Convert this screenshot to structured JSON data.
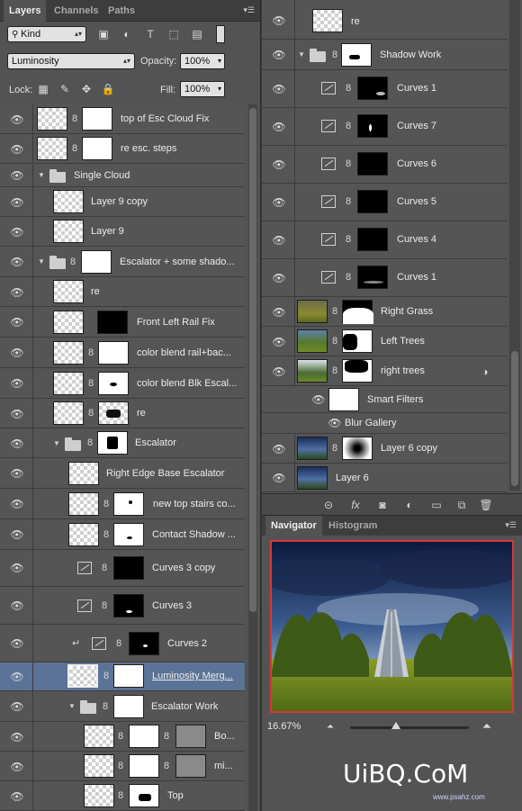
{
  "panel_tabs": [
    "Layers",
    "Channels",
    "Paths"
  ],
  "filter": {
    "kind_label": "Kind"
  },
  "blend": {
    "mode": "Luminosity",
    "opacity_label": "Opacity:",
    "opacity": "100%",
    "lock_label": "Lock:",
    "fill_label": "Fill:",
    "fill": "100%"
  },
  "layers_left": [
    {
      "name": "top of Esc Cloud Fix"
    },
    {
      "name": "re esc. steps"
    },
    {
      "name": "Single Cloud"
    },
    {
      "name": "Layer 9 copy"
    },
    {
      "name": "Layer 9"
    },
    {
      "name": "Escalator + some shado..."
    },
    {
      "name": "re"
    },
    {
      "name": "Front Left Rail Fix"
    },
    {
      "name": "color blend rail+bac..."
    },
    {
      "name": "color blend Blk Escal..."
    },
    {
      "name": "re"
    },
    {
      "name": "Escalator"
    },
    {
      "name": "Right Edge Base Escalator"
    },
    {
      "name": "new top stairs co..."
    },
    {
      "name": "Contact Shadow ..."
    },
    {
      "name": "Curves 3 copy"
    },
    {
      "name": "Curves 3"
    },
    {
      "name": "Curves 2"
    },
    {
      "name": "Luminosity Merg..."
    },
    {
      "name": "Escalator Work"
    },
    {
      "name": "Bo..."
    },
    {
      "name": "mi..."
    },
    {
      "name": "Top"
    }
  ],
  "layers_right": [
    {
      "name": "re"
    },
    {
      "name": "Shadow Work"
    },
    {
      "name": "Curves 1"
    },
    {
      "name": "Curves 7"
    },
    {
      "name": "Curves 6"
    },
    {
      "name": "Curves 5"
    },
    {
      "name": "Curves 4"
    },
    {
      "name": "Curves 1"
    },
    {
      "name": "Right Grass"
    },
    {
      "name": "Left Trees"
    },
    {
      "name": "right trees"
    },
    {
      "name": "Smart Filters"
    },
    {
      "name": "Blur Gallery"
    },
    {
      "name": "Layer 6 copy"
    },
    {
      "name": "Layer 6"
    }
  ],
  "navigator": {
    "tabs": [
      "Navigator",
      "Histogram"
    ],
    "zoom": "16.67%"
  },
  "watermark": {
    "main": "UiBQ.CoM",
    "sub": "www.psahz.com"
  },
  "colors": {
    "panel": "#535353",
    "selected_row": "#5b7396",
    "preview_border": "#d23a3a"
  }
}
